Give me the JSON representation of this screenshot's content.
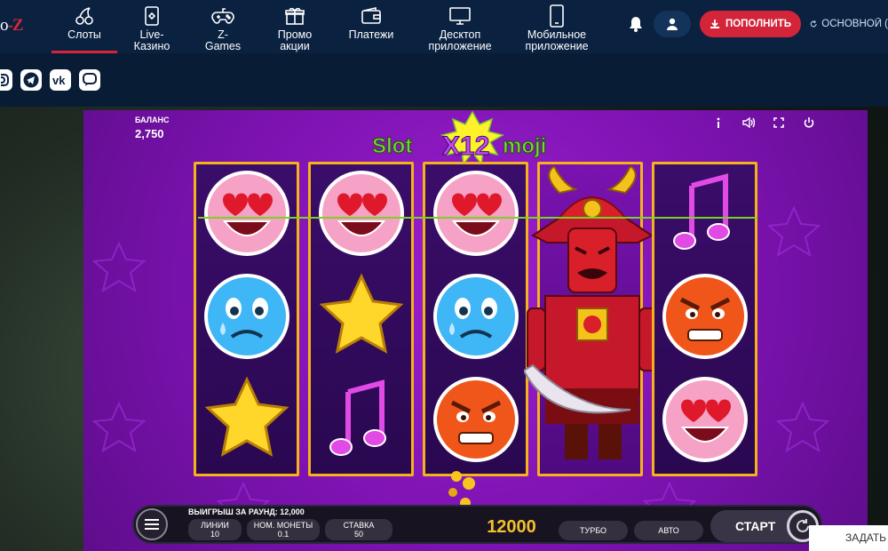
{
  "header": {
    "logo_text": "O-Z",
    "nav": [
      {
        "label": "Слоты",
        "icon": "cherries-icon",
        "active": true
      },
      {
        "label": "Live-\nКазино",
        "icon": "phone-card-icon",
        "active": false
      },
      {
        "label": "Z-\nGames",
        "icon": "gamepad-icon",
        "active": false
      },
      {
        "label": "Промо\nакции",
        "icon": "gift-icon",
        "active": false
      },
      {
        "label": "Платежи",
        "icon": "wallet-icon",
        "active": false
      },
      {
        "label": "Десктоп\nприложение",
        "icon": "monitor-icon",
        "active": false
      },
      {
        "label": "Мобильное\nприложение",
        "icon": "smartphone-icon",
        "active": false
      }
    ],
    "deposit_label": "ПОПОЛНИТЬ",
    "account_label": "ОСНОВНОЙ (",
    "accent_color": "#d3243a"
  },
  "social": [
    "instagram-icon",
    "telegram-icon",
    "vk-icon",
    "chat-icon"
  ],
  "game": {
    "balance_label": "БАЛАНС",
    "balance_value": "2,750",
    "title": "SlotX12moji",
    "reels": [
      [
        "heart-eyes-emoji",
        "sad-emoji",
        "star-symbol"
      ],
      [
        "heart-eyes-emoji",
        "star-symbol",
        "music-note-symbol"
      ],
      [
        "heart-eyes-emoji",
        "sad-emoji",
        "angry-emoji"
      ],
      [
        "samurai-wild",
        "samurai-wild",
        "samurai-wild"
      ],
      [
        "music-note-symbol",
        "angry-emoji",
        "heart-eyes-emoji"
      ]
    ],
    "round_win_label": "ВЫИГРЫШ ЗА РАУНД: 12,000",
    "lines_label": "ЛИНИИ",
    "lines_value": "10",
    "coin_label": "НОМ. МОНЕТЫ",
    "coin_value": "0.1",
    "bet_label": "СТАВКА",
    "bet_value": "50",
    "win_amount": "12000",
    "turbo_label": "ТУРБО",
    "auto_label": "АВТО",
    "start_label": "СТАРТ"
  },
  "ask_label": "ЗАДАТЬ"
}
